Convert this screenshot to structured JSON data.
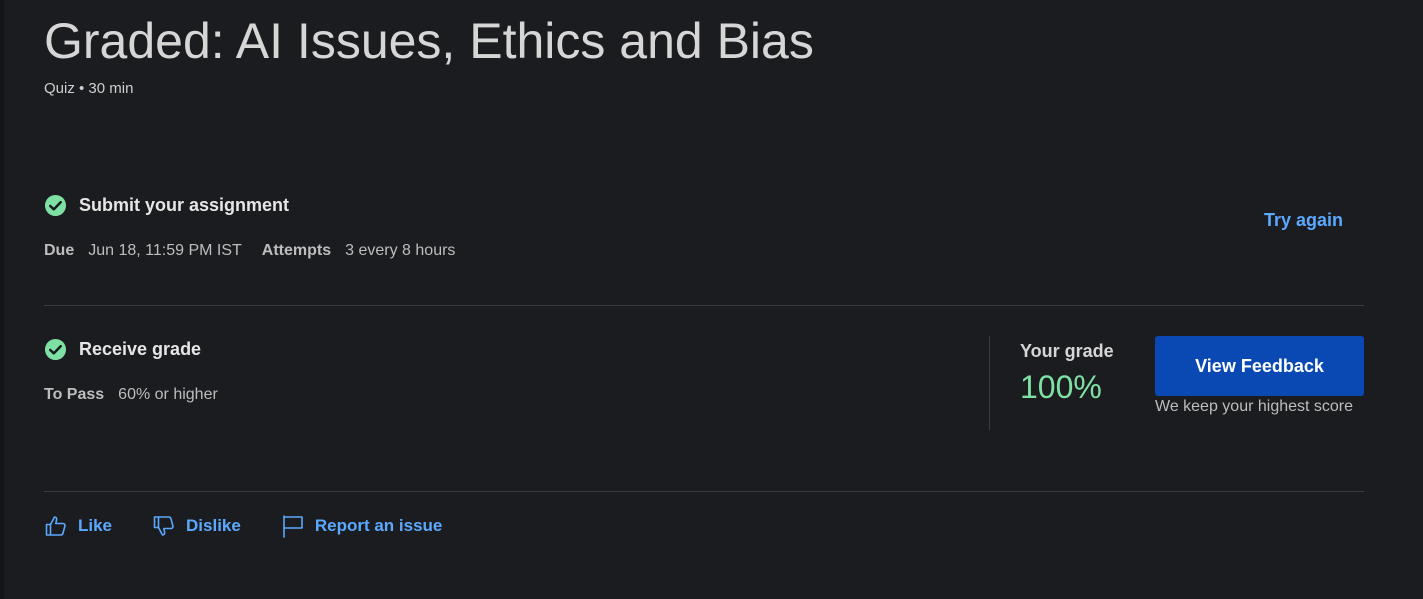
{
  "header": {
    "title": "Graded: AI Issues, Ethics and Bias",
    "meta": "Quiz • 30 min"
  },
  "submit": {
    "title": "Submit your assignment",
    "due_label": "Due",
    "due_value": "Jun 18, 11:59 PM IST",
    "attempts_label": "Attempts",
    "attempts_value": "3 every 8 hours",
    "try_again": "Try again"
  },
  "grade": {
    "title": "Receive grade",
    "to_pass_label": "To Pass",
    "to_pass_value": "60% or higher",
    "your_grade_label": "Your grade",
    "your_grade_value": "100%",
    "feedback_button": "View Feedback",
    "feedback_note": "We keep your highest score"
  },
  "actions": {
    "like": "Like",
    "dislike": "Dislike",
    "report": "Report an issue"
  },
  "colors": {
    "background": "#1b1c1f",
    "accent_link": "#5aa9ff",
    "success": "#7ee0a3",
    "primary_button": "#0a49b3"
  },
  "icons": {
    "check": "check-circle-icon",
    "like": "thumbs-up-icon",
    "dislike": "thumbs-down-icon",
    "report": "flag-icon"
  }
}
